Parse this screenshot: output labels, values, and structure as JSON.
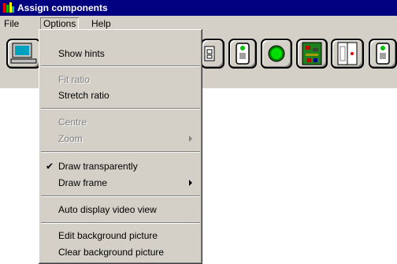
{
  "window": {
    "title": "Assign components"
  },
  "menubar": {
    "items": [
      {
        "label": "File"
      },
      {
        "label": "Options"
      },
      {
        "label": "Help"
      }
    ]
  },
  "options_menu": {
    "items": [
      {
        "label": "Show hints",
        "enabled": true
      },
      {
        "label": "Fit ratio",
        "enabled": false
      },
      {
        "label": "Stretch ratio",
        "enabled": true
      },
      {
        "label": "Centre",
        "enabled": false
      },
      {
        "label": "Zoom",
        "enabled": false,
        "submenu": true
      },
      {
        "label": "Draw transparently",
        "enabled": true,
        "checked": true
      },
      {
        "label": "Draw frame",
        "enabled": true,
        "submenu": true
      },
      {
        "label": "Auto display video view",
        "enabled": true
      },
      {
        "label": "Edit background picture",
        "enabled": true
      },
      {
        "label": "Clear background picture",
        "enabled": true
      }
    ]
  },
  "toolbar": {
    "buttons": [
      {
        "icon": "computer-icon"
      },
      {
        "icon": "device-icon"
      },
      {
        "icon": "keypad-module-icon"
      },
      {
        "icon": "green-led-icon"
      },
      {
        "icon": "circuit-board-icon"
      },
      {
        "icon": "door-contact-icon"
      },
      {
        "icon": "keypad-module-icon"
      }
    ]
  },
  "colors": {
    "titlebar": "#000080",
    "face": "#d4d0c8",
    "disabled_text": "#808080"
  }
}
